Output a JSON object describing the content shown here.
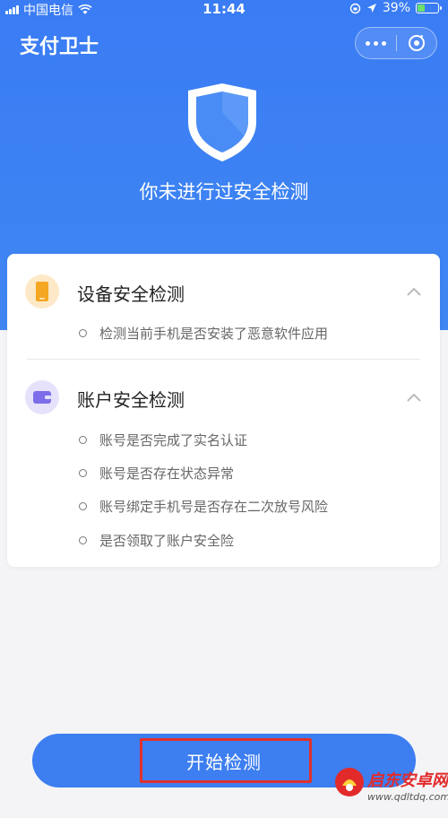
{
  "status_bar": {
    "carrier": "中国电信",
    "time": "11:44",
    "battery_percent": "39%",
    "battery_level": 0.39,
    "icons": [
      "signal-icon",
      "wifi-icon",
      "rotation-lock-icon",
      "location-icon",
      "battery-icon"
    ]
  },
  "nav": {
    "title": "支付卫士",
    "more_icon": "more-icon",
    "close_icon": "close-icon"
  },
  "hero": {
    "shield_icon": "shield-icon",
    "status_text": "你未进行过安全检测"
  },
  "sections": [
    {
      "title": "设备安全检测",
      "icon": "phone-icon",
      "icon_color": "#f5a623",
      "items": [
        "检测当前手机是否安装了恶意软件应用"
      ]
    },
    {
      "title": "账户安全检测",
      "icon": "wallet-icon",
      "icon_color": "#7b6ee8",
      "items": [
        "账号是否完成了实名认证",
        "账号是否存在状态异常",
        "账号绑定手机号是否存在二次放号风险",
        "是否领取了账户安全险"
      ]
    }
  ],
  "start_button": {
    "label": "开始检测"
  },
  "watermark": {
    "title": "启东安卓网",
    "url": "www.qdltdq.com"
  },
  "colors": {
    "brand_blue": "#3a7cf4",
    "highlight_red": "#e0302b"
  }
}
